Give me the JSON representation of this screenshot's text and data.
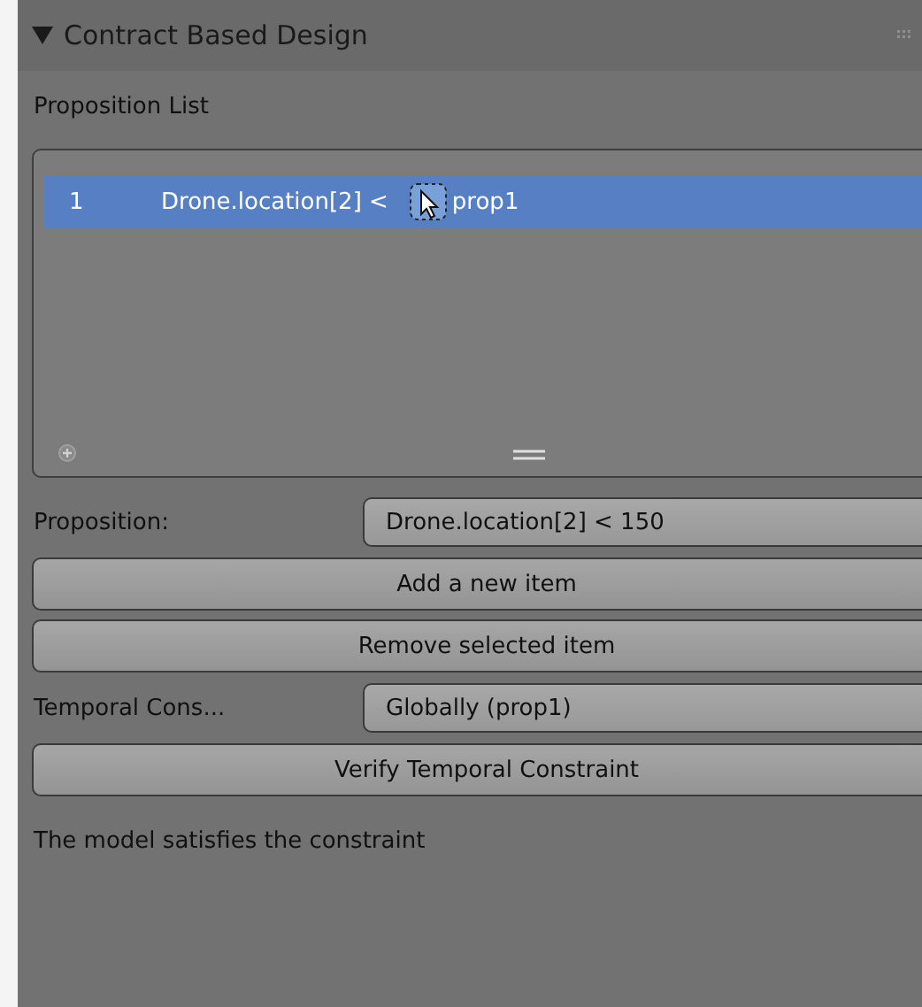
{
  "panel": {
    "title": "Contract Based Design",
    "expanded": true
  },
  "proposition_list": {
    "label": "Proposition List",
    "items": [
      {
        "index": "1",
        "expression": "Drone.location[2] <",
        "name": "prop1",
        "selected": true
      }
    ]
  },
  "controls": [
    {
      "kind": "field",
      "label": "Proposition:",
      "value": "Drone.location[2] < 150"
    },
    {
      "kind": "button",
      "label": "Add a new item"
    },
    {
      "kind": "button",
      "label": "Remove selected item"
    },
    {
      "kind": "field",
      "label": "Temporal Cons...",
      "value": "Globally (prop1)"
    },
    {
      "kind": "button",
      "label": "Verify Temporal Constraint"
    },
    {
      "kind": "text",
      "label": "The model satisfies the constraint"
    }
  ]
}
